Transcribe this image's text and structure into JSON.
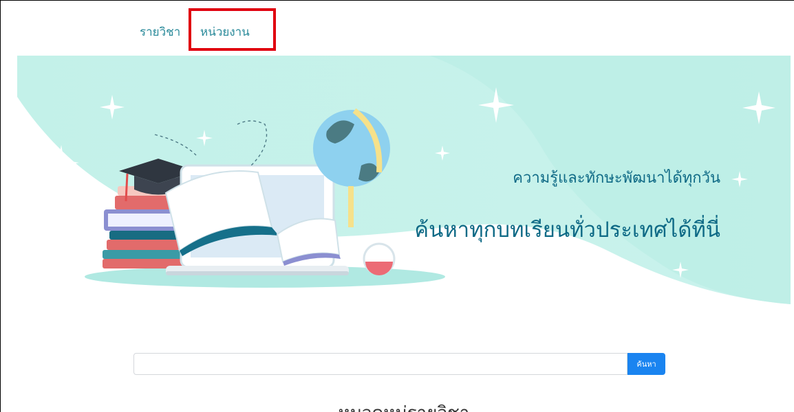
{
  "nav": {
    "items": [
      {
        "label": "รายวิชา"
      },
      {
        "label": "หน่วยงาน"
      }
    ]
  },
  "hero": {
    "subtitle": "ความรู้และทักษะพัฒนาได้ทุกวัน",
    "title": "ค้นหาทุกบทเรียนทั่วประเทศได้ที่นี่"
  },
  "search": {
    "value": "",
    "placeholder": "",
    "button_label": "ค้นหา"
  },
  "section": {
    "heading": "หมวดหมู่รายวิชา"
  },
  "colors": {
    "nav_text": "#2a8a9a",
    "highlight_border": "#e0000f",
    "hero_bg": "#b8efe6",
    "hero_text": "#0f6a86",
    "search_button": "#1a84f0"
  },
  "icons": [
    "graduation-cap-icon",
    "globe-icon",
    "open-book-icon",
    "laptop-icon",
    "flask-icon",
    "sparkle-icon"
  ]
}
